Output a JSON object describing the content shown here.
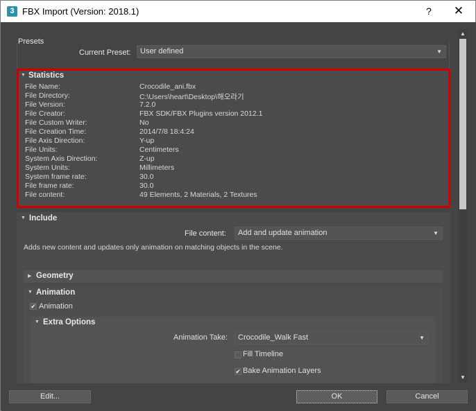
{
  "window": {
    "app_icon_glyph": "3",
    "title": "FBX Import (Version: 2018.1)",
    "help_glyph": "?",
    "close_glyph": "✕"
  },
  "presets": {
    "group_label": "Presets",
    "current_preset_label": "Current Preset:",
    "current_preset_value": "User defined"
  },
  "statistics": {
    "title": "Statistics",
    "rows": [
      {
        "key": "File Name:",
        "value": "Crocodile_ani.fbx"
      },
      {
        "key": "File Directory:",
        "value": "C:\\Users\\heart\\Desktop\\해오라기"
      },
      {
        "key": "File Version:",
        "value": "7.2.0"
      },
      {
        "key": "File Creator:",
        "value": "FBX SDK/FBX Plugins version 2012.1"
      },
      {
        "key": "File Custom Writer:",
        "value": "No"
      },
      {
        "key": "File Creation Time:",
        "value": "2014/7/8  18:4:24"
      },
      {
        "key": "File Axis Direction:",
        "value": "Y-up"
      },
      {
        "key": "File Units:",
        "value": "Centimeters"
      },
      {
        "key": "System Axis Direction:",
        "value": "Z-up"
      },
      {
        "key": "System Units:",
        "value": "Millimeters"
      },
      {
        "key": "System frame rate:",
        "value": "30.0"
      },
      {
        "key": "File frame rate:",
        "value": "30.0"
      },
      {
        "key": "File content:",
        "value": "49 Elements,   2 Materials,   2 Textures"
      }
    ]
  },
  "include": {
    "title": "Include",
    "file_content_label": "File content:",
    "file_content_value": "Add and update animation",
    "description": "Adds new content and updates only animation on matching objects in the scene."
  },
  "geometry": {
    "title": "Geometry"
  },
  "animation": {
    "title": "Animation",
    "checkbox_label": "Animation",
    "checked": true,
    "extra_options": {
      "title": "Extra Options",
      "take_label": "Animation Take:",
      "take_value": "Crocodile_Walk Fast",
      "fill_timeline_label": "Fill Timeline",
      "fill_timeline_checked": false,
      "bake_layers_label": "Bake Animation Layers",
      "bake_layers_checked": true
    }
  },
  "footer": {
    "edit_label": "Edit...",
    "ok_label": "OK",
    "cancel_label": "Cancel"
  },
  "icons": {
    "expanded_triangle": "▼",
    "collapsed_triangle": "▶",
    "dropdown_arrow": "▼",
    "check_mark": "✔"
  },
  "colors": {
    "highlight_border": "#d10000",
    "panel_bg": "#444444",
    "section_bg": "#4b4b4b"
  }
}
